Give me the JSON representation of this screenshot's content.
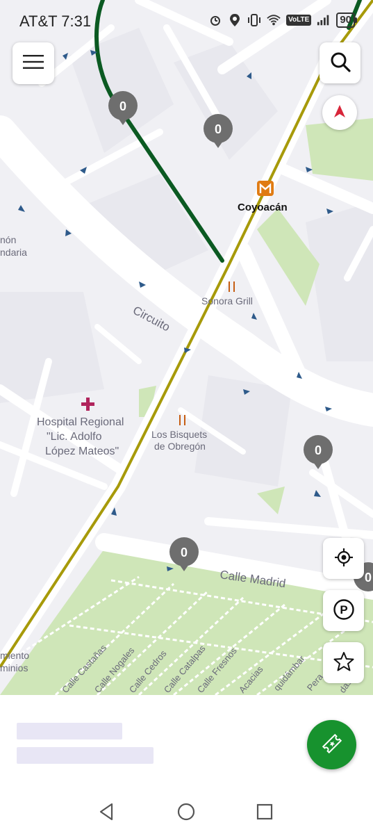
{
  "status_bar": {
    "carrier_time": "AT&T 7:31",
    "volte": "VoLTE",
    "battery": "90",
    "icons": [
      "alarm-icon",
      "location-icon",
      "vibrate-icon",
      "wifi-icon",
      "signal-icon"
    ]
  },
  "map": {
    "labels": {
      "coyoacan": "Coyoacán",
      "sonora_grill": "Sonora Grill",
      "circuito": "Circuito",
      "hospital_line1": "Hospital Regional",
      "hospital_line2": "\"Lic. Adolfo",
      "hospital_line3": "López Mateos\"",
      "bisquets_line1": "Los Bisquets",
      "bisquets_line2": "de Obregón",
      "calle_madrid": "Calle Madrid",
      "left_edge_1": "nón",
      "left_edge_2": "ndaria",
      "left_edge_3": "miento",
      "left_edge_4": "minios",
      "castanas": "Calle Castañas",
      "nogales": "Calle Nogales",
      "cedros": "Calle Cedros",
      "catalpas": "Calle Catalpas",
      "fresnos": "Calle Fresnos",
      "acacias": "Acacias",
      "liquidambar": "quidámbar",
      "perales": "Pera",
      "olmos": "das"
    },
    "parking_markers": [
      "0",
      "0",
      "0",
      "0",
      "0"
    ],
    "colors": {
      "route_green": "#0b5a22",
      "metro_line": "#a79a0a",
      "park": "#cfe6b8",
      "marker": "#6e6e6e"
    }
  },
  "controls": {
    "menu": "hamburger-menu-icon",
    "search": "search-icon",
    "compass": "compass-icon",
    "my_location": "crosshair-icon",
    "parking": "parking-icon",
    "favorites": "star-icon"
  },
  "bottom_sheet": {
    "fab": "ticket-icon"
  },
  "nav_bar": {
    "back": "back-icon",
    "home": "home-icon",
    "recents": "recents-icon"
  }
}
